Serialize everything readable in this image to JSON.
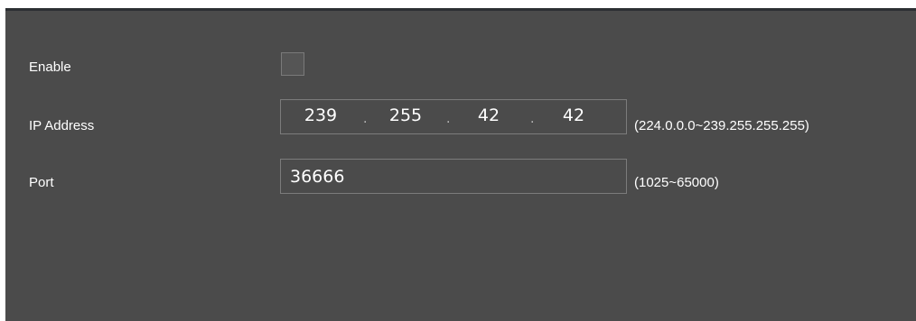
{
  "enable": {
    "label": "Enable",
    "checked": false
  },
  "ip_address": {
    "label": "IP Address",
    "octets": [
      "239",
      "255",
      "42",
      "42"
    ],
    "separator": ".",
    "range_hint": "(224.0.0.0~239.255.255.255)"
  },
  "port": {
    "label": "Port",
    "value": "36666",
    "range_hint": "(1025~65000)"
  },
  "colors": {
    "panel_background": "#4b4b4b",
    "field_border": "#7c7c7c",
    "text": "#ffffff"
  }
}
